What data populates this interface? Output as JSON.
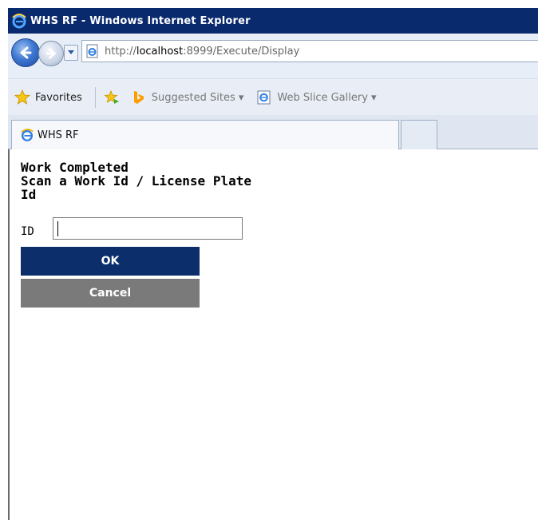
{
  "window": {
    "title": "WHS RF - Windows Internet Explorer"
  },
  "address": {
    "url_prefix": "http://",
    "url_host": "localhost",
    "url_rest": ":8999/Execute/Display"
  },
  "favorites_bar": {
    "favorites_label": "Favorites",
    "suggested_sites_label": "Suggested Sites ▾",
    "web_slice_label": "Web Slice Gallery ▾"
  },
  "tab": {
    "title": "WHS RF"
  },
  "form": {
    "heading_line1": "Work Completed",
    "heading_line2": "Scan a Work Id / License Plate",
    "heading_line3": "Id",
    "id_label": "ID",
    "id_value": "",
    "ok_label": "OK",
    "cancel_label": "Cancel"
  },
  "colors": {
    "titlebar": "#0a2a6e",
    "ok_button": "#0c2f6c",
    "cancel_button": "#7a7a7a"
  },
  "icons": [
    "ie-logo-icon",
    "back-arrow-icon",
    "forward-arrow-icon",
    "dropdown-arrow-icon",
    "page-icon",
    "favorites-star-icon",
    "add-favorites-icon",
    "bing-icon"
  ]
}
